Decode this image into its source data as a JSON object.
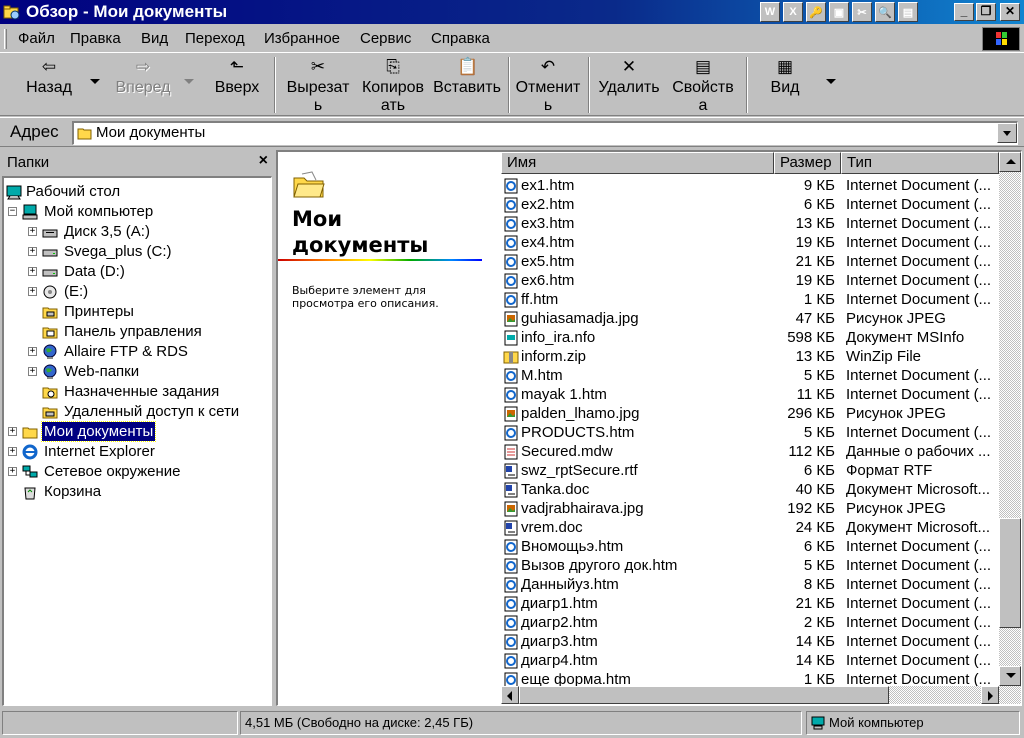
{
  "window": {
    "title": "Обзор - Мои документы"
  },
  "tray_icons": [
    "W",
    "X",
    "🔑",
    "▣",
    "✂",
    "🔍",
    "▤"
  ],
  "menu": [
    "Файл",
    "Правка",
    "Вид",
    "Переход",
    "Избранное",
    "Сервис",
    "Справка"
  ],
  "toolbar": {
    "back": "Назад",
    "forward": "Вперед",
    "up": "Вверх",
    "cut": [
      "Вырезат",
      "ь"
    ],
    "copy": [
      "Копиров",
      "ать"
    ],
    "paste": "Вставить",
    "undo": [
      "Отменит",
      "ь"
    ],
    "delete": "Удалить",
    "properties": [
      "Свойств",
      "а"
    ],
    "view": "Вид"
  },
  "address": {
    "label": "Адрес",
    "value": "Мои документы"
  },
  "folders": {
    "title": "Папки",
    "items": [
      {
        "label": "Рабочий стол",
        "icon": "desktop-icon",
        "indent": 0,
        "expander": ""
      },
      {
        "label": "Мой компьютер",
        "icon": "computer-icon",
        "indent": 1,
        "expander": "−"
      },
      {
        "label": "Диск 3,5 (A:)",
        "icon": "floppy-drive-icon",
        "indent": 2,
        "expander": "+"
      },
      {
        "label": "Svega_plus (C:)",
        "icon": "hard-drive-icon",
        "indent": 2,
        "expander": "+"
      },
      {
        "label": "Data (D:)",
        "icon": "hard-drive-icon",
        "indent": 2,
        "expander": "+"
      },
      {
        "label": " (E:)",
        "icon": "cd-drive-icon",
        "indent": 2,
        "expander": "+"
      },
      {
        "label": "Принтеры",
        "icon": "printers-folder-icon",
        "indent": 2,
        "expander": ""
      },
      {
        "label": "Панель управления",
        "icon": "control-panel-icon",
        "indent": 2,
        "expander": ""
      },
      {
        "label": "Allaire FTP & RDS",
        "icon": "globe-icon",
        "indent": 2,
        "expander": "+"
      },
      {
        "label": "Web-папки",
        "icon": "globe-icon",
        "indent": 2,
        "expander": "+"
      },
      {
        "label": "Назначенные задания",
        "icon": "scheduled-tasks-icon",
        "indent": 2,
        "expander": ""
      },
      {
        "label": "Удаленный доступ к сети",
        "icon": "dialup-icon",
        "indent": 2,
        "expander": ""
      },
      {
        "label": "Мои документы",
        "icon": "folder-icon",
        "indent": 1,
        "expander": "+",
        "selected": true
      },
      {
        "label": "Internet Explorer",
        "icon": "ie-icon",
        "indent": 1,
        "expander": "+"
      },
      {
        "label": "Сетевое окружение",
        "icon": "network-icon",
        "indent": 1,
        "expander": "+"
      },
      {
        "label": "Корзина",
        "icon": "recycle-bin-icon",
        "indent": 1,
        "expander": ""
      }
    ]
  },
  "info_pane": {
    "title": [
      "Мои",
      "документы"
    ],
    "description": [
      "Выберите элемент для",
      "просмотра его описания."
    ]
  },
  "columns": {
    "name": "Имя",
    "size": "Размер",
    "type": "Тип"
  },
  "files": [
    {
      "name": "ex1.htm",
      "size": "9 КБ",
      "type": "Internet Document (...",
      "icon": "html-icon"
    },
    {
      "name": "ex2.htm",
      "size": "6 КБ",
      "type": "Internet Document (...",
      "icon": "html-icon"
    },
    {
      "name": "ex3.htm",
      "size": "13 КБ",
      "type": "Internet Document (...",
      "icon": "html-icon"
    },
    {
      "name": "ex4.htm",
      "size": "19 КБ",
      "type": "Internet Document (...",
      "icon": "html-icon"
    },
    {
      "name": "ex5.htm",
      "size": "21 КБ",
      "type": "Internet Document (...",
      "icon": "html-icon"
    },
    {
      "name": "ex6.htm",
      "size": "19 КБ",
      "type": "Internet Document (...",
      "icon": "html-icon"
    },
    {
      "name": "ff.htm",
      "size": "1 КБ",
      "type": "Internet Document (...",
      "icon": "html-icon"
    },
    {
      "name": "guhiasamadja.jpg",
      "size": "47 КБ",
      "type": "Рисунок JPEG",
      "icon": "jpeg-icon"
    },
    {
      "name": "info_ira.nfo",
      "size": "598 КБ",
      "type": "Документ MSInfo",
      "icon": "msinfo-icon"
    },
    {
      "name": "inform.zip",
      "size": "13 КБ",
      "type": "WinZip File",
      "icon": "zip-icon"
    },
    {
      "name": "M.htm",
      "size": "5 КБ",
      "type": "Internet Document (...",
      "icon": "html-icon"
    },
    {
      "name": "mayak 1.htm",
      "size": "11 КБ",
      "type": "Internet Document (...",
      "icon": "html-icon"
    },
    {
      "name": "palden_lhamo.jpg",
      "size": "296 КБ",
      "type": "Рисунок JPEG",
      "icon": "jpeg-icon"
    },
    {
      "name": "PRODUCTS.htm",
      "size": "5 КБ",
      "type": "Internet Document (...",
      "icon": "html-icon"
    },
    {
      "name": "Secured.mdw",
      "size": "112 КБ",
      "type": "Данные о рабочих ...",
      "icon": "mdw-icon"
    },
    {
      "name": "swz_rptSecure.rtf",
      "size": "6 КБ",
      "type": "Формат RTF",
      "icon": "rtf-icon"
    },
    {
      "name": "Tanka.doc",
      "size": "40 КБ",
      "type": "Документ Microsoft...",
      "icon": "doc-icon"
    },
    {
      "name": "vadjrabhairava.jpg",
      "size": "192 КБ",
      "type": "Рисунок JPEG",
      "icon": "jpeg-icon"
    },
    {
      "name": "vrem.doc",
      "size": "24 КБ",
      "type": "Документ Microsoft...",
      "icon": "doc-icon"
    },
    {
      "name": "Вномощьэ.htm",
      "size": "6 КБ",
      "type": "Internet Document (...",
      "icon": "html-icon"
    },
    {
      "name": "Вызов другого док.htm",
      "size": "5 КБ",
      "type": "Internet Document (...",
      "icon": "html-icon"
    },
    {
      "name": "Данныйуз.htm",
      "size": "8 КБ",
      "type": "Internet Document (...",
      "icon": "html-icon"
    },
    {
      "name": "диагр1.htm",
      "size": "21 КБ",
      "type": "Internet Document (...",
      "icon": "html-icon"
    },
    {
      "name": "диагр2.htm",
      "size": "2 КБ",
      "type": "Internet Document (...",
      "icon": "html-icon"
    },
    {
      "name": "диагр3.htm",
      "size": "14 КБ",
      "type": "Internet Document (...",
      "icon": "html-icon"
    },
    {
      "name": "диагр4.htm",
      "size": "14 КБ",
      "type": "Internet Document (...",
      "icon": "html-icon"
    },
    {
      "name": "еще форма.htm",
      "size": "1 КБ",
      "type": "Internet Document (...",
      "icon": "html-icon"
    }
  ],
  "vscroll_position": 0.9,
  "status": {
    "left": "",
    "middle": "4,51 МБ (Свободно на диске: 2,45 ГБ)",
    "right": "Мой компьютер"
  },
  "colors": {
    "titlebar": "#000080",
    "selection": "#000080",
    "face": "#c0c0c0"
  }
}
